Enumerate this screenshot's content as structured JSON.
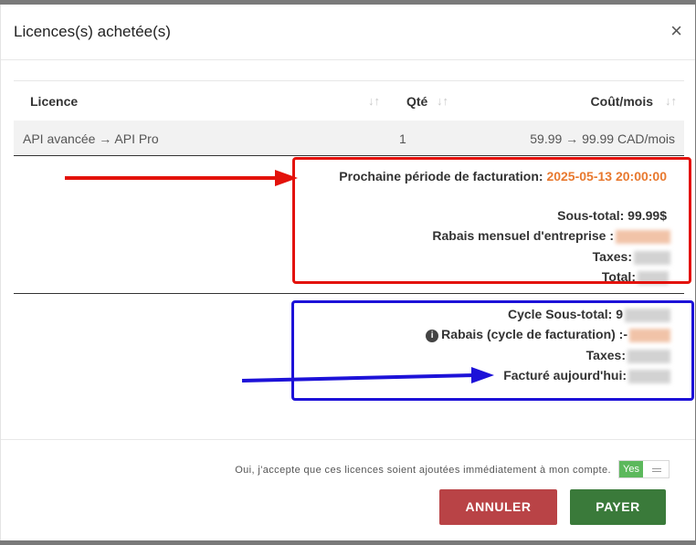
{
  "modal": {
    "title": "Licences(s) achetée(s)",
    "close_glyph": "×"
  },
  "table": {
    "headers": {
      "licence": "Licence",
      "qty": "Qté",
      "cost": "Coût/mois"
    },
    "sort_glyph": "↓↑",
    "rows": [
      {
        "licence": "API avancée → API Pro",
        "qty": "1",
        "cost": "59.99 → 99.99 CAD/mois"
      }
    ]
  },
  "billing": {
    "next_period_label": "Prochaine période de facturation:",
    "next_period_value": "2025-05-13 20:00:00",
    "subtotal_label": "Sous-total: 99.99$",
    "monthly_discount_label": "Rabais mensuel d'entreprise :",
    "taxes_label": "Taxes:",
    "total_label": "Total:",
    "cycle_subtotal_label": "Cycle Sous-total: 9",
    "cycle_discount_label": "Rabais (cycle de facturation) :-",
    "cycle_taxes_label": "Taxes:",
    "billed_today_label": "Facturé aujourd'hui:",
    "info_icon_glyph": "i"
  },
  "footer": {
    "consent_text": "Oui, j'accepte que ces licences soient ajoutées immédiatement à mon compte.",
    "toggle_label": "Yes",
    "cancel_label": "ANNULER",
    "pay_label": "PAYER"
  },
  "colors": {
    "accent_orange": "#e8792f",
    "annotation_red": "#e3120b",
    "annotation_blue": "#1d12d8",
    "cancel_button": "#b94346",
    "pay_button": "#3a7a3a",
    "toggle_on": "#5cb85c"
  }
}
